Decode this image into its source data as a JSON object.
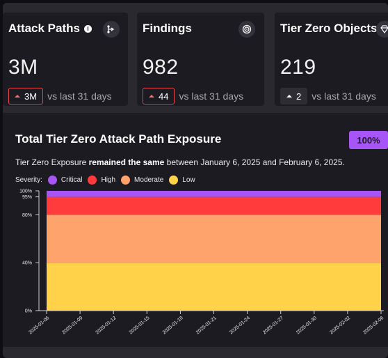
{
  "cards": [
    {
      "title": "Attack Paths",
      "value": "3M",
      "trend_value": "3M",
      "trend_text": "vs last 31 days",
      "icon": "route-icon",
      "info_icon": "info-icon"
    },
    {
      "title": "Findings",
      "value": "982",
      "trend_value": "44",
      "trend_text": "vs last 31 days",
      "icon": "findings-spiral-icon"
    },
    {
      "title": "Tier Zero Objects",
      "value": "219",
      "trend_value": "2",
      "trend_text": "vs last 31 days",
      "icon": "gem-icon"
    }
  ],
  "exposure": {
    "title": "Total Tier Zero Attack Path Exposure",
    "badge": "100%",
    "sentence_prefix": "Tier Zero Exposure ",
    "sentence_bold": "remained the same",
    "sentence_suffix": " between January 6, 2025 and February 6, 2025.",
    "severity_label": "Severity:",
    "legend": [
      {
        "label": "Critical",
        "color": "#a855f7"
      },
      {
        "label": "High",
        "color": "#ff3b3b"
      },
      {
        "label": "Moderate",
        "color": "#ffa36c"
      },
      {
        "label": "Low",
        "color": "#ffd24a"
      }
    ]
  },
  "colors": {
    "accent": "#a855f7",
    "trend_up": "#e5484d"
  },
  "chart_data": {
    "type": "area",
    "x": [
      "2025-01-06",
      "2025-01-09",
      "2025-01-12",
      "2025-01-15",
      "2025-01-18",
      "2025-01-21",
      "2025-01-24",
      "2025-01-27",
      "2025-01-30",
      "2025-02-02",
      "2025-02-06"
    ],
    "series": [
      {
        "name": "Low",
        "values": [
          40,
          40,
          40,
          40,
          40,
          40,
          40,
          40,
          40,
          40,
          40
        ]
      },
      {
        "name": "Moderate",
        "values": [
          40,
          40,
          40,
          40,
          40,
          40,
          40,
          40,
          40,
          40,
          40
        ]
      },
      {
        "name": "High",
        "values": [
          15,
          15,
          15,
          15,
          15,
          15,
          15,
          15,
          15,
          15,
          15
        ]
      },
      {
        "name": "Critical",
        "values": [
          5,
          5,
          5,
          5,
          5,
          5,
          5,
          5,
          5,
          5,
          5
        ]
      }
    ],
    "stacked": true,
    "y_ticks": [
      "0%",
      "40%",
      "80%",
      "95%",
      "100%"
    ],
    "y_tick_values": [
      0,
      40,
      80,
      95,
      100
    ],
    "ylim": [
      0,
      100
    ],
    "grid": false
  }
}
